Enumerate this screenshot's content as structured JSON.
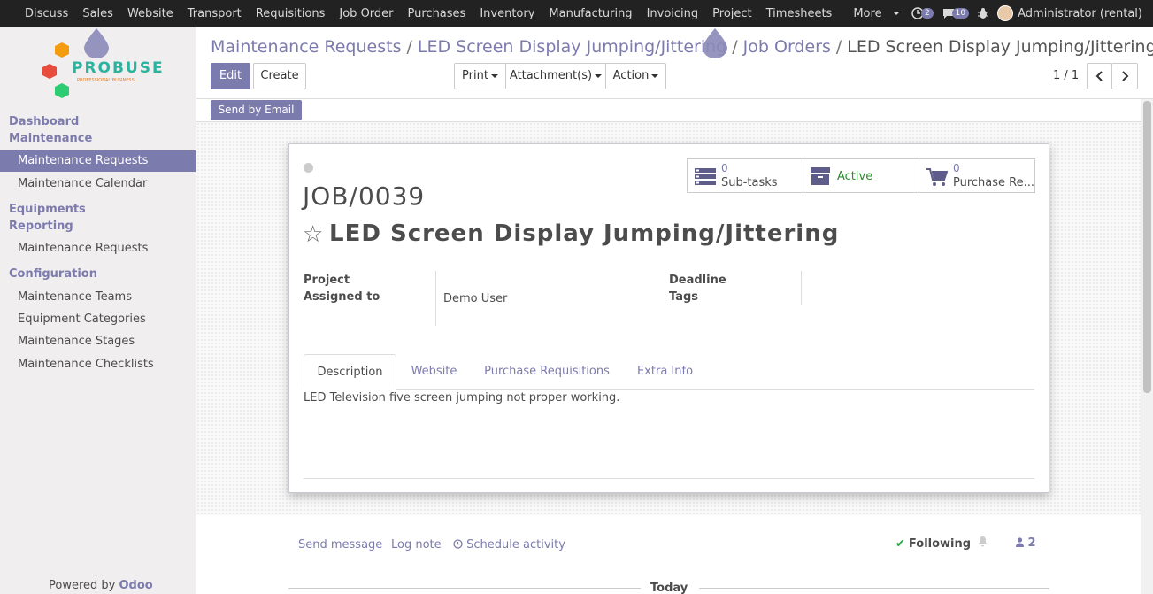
{
  "topbar": {
    "menu": [
      "Discuss",
      "Sales",
      "Website",
      "Transport",
      "Requisitions",
      "Job Order",
      "Purchases",
      "Inventory",
      "Manufacturing",
      "Invoicing",
      "Project",
      "Timesheets",
      "More"
    ],
    "messages_count": "2",
    "chat_count": "10",
    "user": "Administrator (rental)"
  },
  "sidebar": {
    "logo_text": "PROBUSE",
    "logo_sub": "PROFESSIONAL BUSINESS",
    "sections": [
      {
        "title": "Dashboard"
      },
      {
        "title": "Maintenance",
        "items": [
          "Maintenance Requests",
          "Maintenance Calendar"
        ]
      },
      {
        "title": "Equipments"
      },
      {
        "title": "Reporting",
        "items": [
          "Maintenance Requests"
        ]
      },
      {
        "title": "Configuration",
        "items": [
          "Maintenance Teams",
          "Equipment Categories",
          "Maintenance Stages",
          "Maintenance Checklists"
        ]
      }
    ],
    "powered_by": "Powered by",
    "powered_brand": "Odoo"
  },
  "breadcrumb": {
    "items": [
      "Maintenance Requests",
      "LED Screen Display Jumping/Jittering",
      "Job Orders"
    ],
    "current": "LED Screen Display Jumping/Jittering"
  },
  "buttons": {
    "edit": "Edit",
    "create": "Create",
    "print": "Print",
    "attachments": "Attachment(s)",
    "action": "Action",
    "send_email": "Send by Email"
  },
  "pager": "1 / 1",
  "record": {
    "name": "JOB/0039",
    "title": "LED Screen Display Jumping/Jittering",
    "smart_buttons": {
      "subtasks_count": "0",
      "subtasks_label": "Sub-tasks",
      "active_label": "Active",
      "purchase_count": "0",
      "purchase_label": "Purchase Re..."
    },
    "fields": {
      "project_label": "Project",
      "assigned_label": "Assigned to",
      "assigned_value": "Demo User",
      "deadline_label": "Deadline",
      "tags_label": "Tags"
    },
    "tabs": [
      "Description",
      "Website",
      "Purchase Requisitions",
      "Extra Info"
    ],
    "description": "LED Television five screen jumping not proper working."
  },
  "chatter": {
    "send_message": "Send message",
    "log_note": "Log note",
    "schedule_activity": "Schedule activity",
    "following": "Following",
    "followers_count": "2",
    "today": "Today"
  },
  "colors": {
    "primary": "#7c7bad",
    "topbar": "#222222",
    "active_green": "#2e8b2e"
  }
}
